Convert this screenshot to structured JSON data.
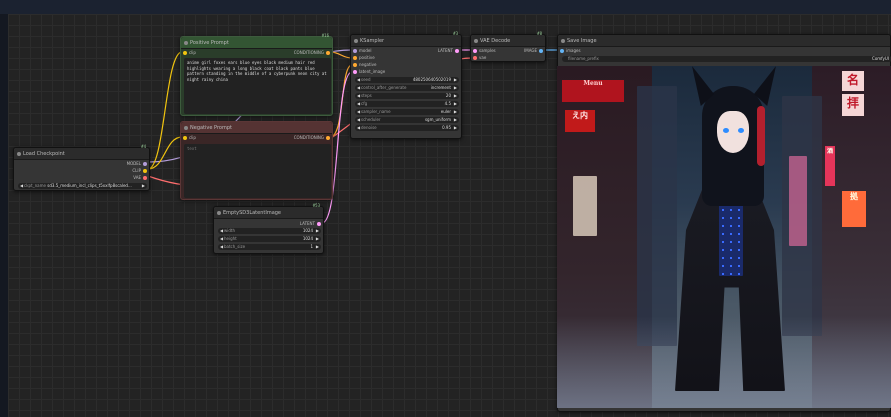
{
  "nodes": {
    "load_checkpoint": {
      "title": "Load Checkpoint",
      "id": "#4",
      "outputs": [
        "MODEL",
        "CLIP",
        "VAE"
      ],
      "ckpt_label": "ckpt_name",
      "ckpt_value": "sd3.5_medium_incl_clips_t5xxlfp8scaled..."
    },
    "positive_prompt": {
      "title": "Positive Prompt",
      "id": "#16",
      "input": "clip",
      "output": "CONDITIONING",
      "text": "anime girl foxes ears blue eyes black medium hair red highlights wearing a long black coat black pants blue pattern standing in the middle of a cyberpunk neon city at night rainy china"
    },
    "negative_prompt": {
      "title": "Negative Prompt",
      "id": "",
      "input": "clip",
      "output": "CONDITIONING",
      "text_placeholder": "text"
    },
    "ksampler": {
      "title": "KSampler",
      "id": "#3",
      "inputs": [
        "model",
        "positive",
        "negative",
        "latent_image"
      ],
      "output": "LATENT",
      "widgets": [
        {
          "label": "seed",
          "value": "480250640502019"
        },
        {
          "label": "control_after_generate",
          "value": "increment"
        },
        {
          "label": "steps",
          "value": "20"
        },
        {
          "label": "cfg",
          "value": "4.5"
        },
        {
          "label": "sampler_name",
          "value": "euler"
        },
        {
          "label": "scheduler",
          "value": "sgm_uniform"
        },
        {
          "label": "denoise",
          "value": "0.95"
        }
      ]
    },
    "vae_decode": {
      "title": "VAE Decode",
      "id": "#8",
      "inputs": [
        "samples",
        "vae"
      ],
      "output": "IMAGE"
    },
    "save_image": {
      "title": "Save Image",
      "id": "",
      "input": "images",
      "prefix_label": "filename_prefix",
      "prefix_value": "ComfyUI"
    },
    "empty_latent": {
      "title": "EmptySD3LatentImage",
      "id": "#53",
      "output": "LATENT",
      "widgets": [
        {
          "label": "width",
          "value": "1024"
        },
        {
          "label": "height",
          "value": "1024"
        },
        {
          "label": "batch_size",
          "value": "1"
        }
      ]
    }
  },
  "preview_signs": [
    "名",
    "拝",
    "Menu",
    "え内",
    "拠",
    "酒"
  ],
  "colors": {
    "model": "#b39ddb",
    "clip": "#f1c40f",
    "vae": "#ff6e6e",
    "conditioning": "#ffa931",
    "latent": "#ff9cf9",
    "image": "#64b5f6"
  }
}
